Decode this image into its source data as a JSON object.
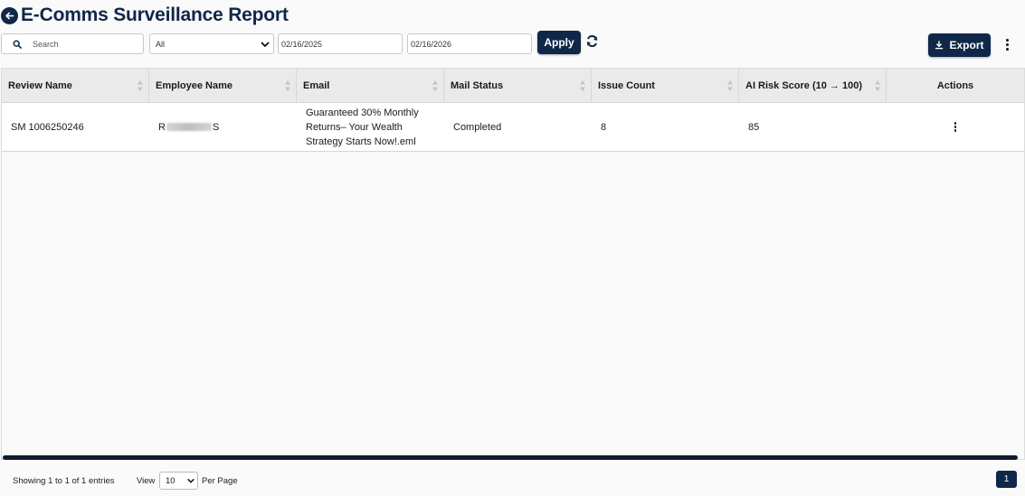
{
  "header": {
    "title": "E-Comms Surveillance Report"
  },
  "filters": {
    "search_placeholder": "Search",
    "status_select": "All",
    "date_from": "02/16/2025",
    "date_to": "02/16/2026",
    "apply_label": "Apply"
  },
  "toolbar": {
    "export_label": "Export"
  },
  "table": {
    "columns": [
      "Review Name",
      "Employee Name",
      "Email",
      "Mail Status",
      "Issue Count",
      "AI Risk Score (10 → 100)",
      "Actions"
    ],
    "rows": [
      {
        "review_name": "SM 1006250246",
        "employee_prefix": "R",
        "employee_suffix": "S",
        "email": "Guaranteed 30% Monthly Returns– Your Wealth Strategy Starts Now!.eml",
        "mail_status": "Completed",
        "issue_count": "8",
        "risk_score": "85"
      }
    ]
  },
  "footer": {
    "showing": "Showing 1 to 1 of 1 entries",
    "view_label": "View",
    "per_page_value": "10",
    "per_page_label": "Per Page",
    "current_page": "1"
  },
  "colors": {
    "primary": "#0f2748",
    "header_bg": "#eaeaea",
    "page_bg": "#fafafa"
  }
}
